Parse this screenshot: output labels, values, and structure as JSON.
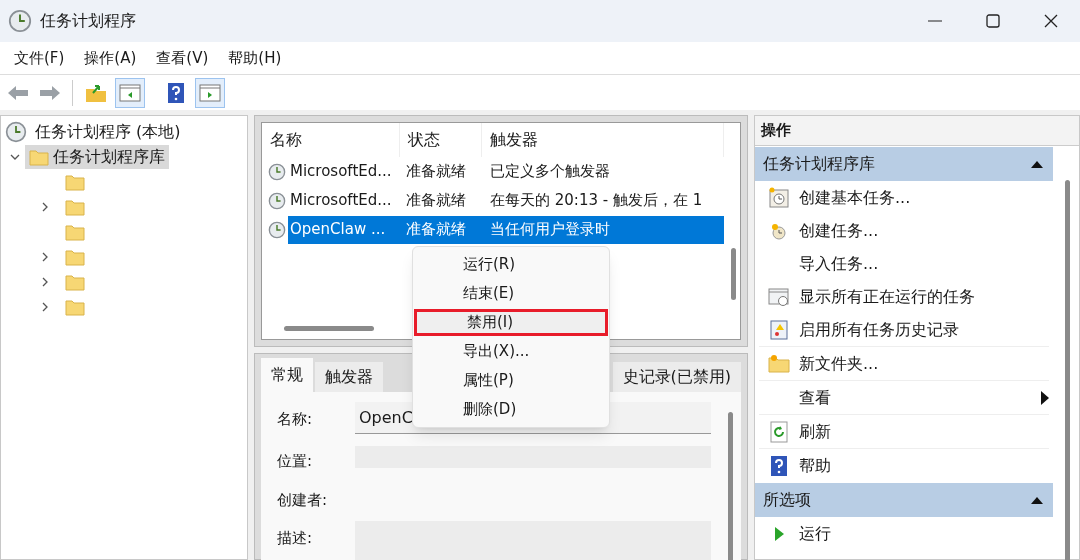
{
  "window": {
    "title": "任务计划程序"
  },
  "menu_bar": [
    "文件(F)",
    "操作(A)",
    "查看(V)",
    "帮助(H)"
  ],
  "tree": {
    "label": "任务计划程序 (本地)",
    "children": [
      {
        "label": "任务计划程序库",
        "selected": true,
        "expanded": true,
        "children": [
          {
            "expandable": false
          },
          {
            "expandable": true
          },
          {
            "expandable": false
          },
          {
            "expandable": true
          },
          {
            "expandable": true
          },
          {
            "expandable": true
          }
        ]
      }
    ]
  },
  "task_table": {
    "columns": [
      "名称",
      "状态",
      "触发器"
    ],
    "rows": [
      {
        "name": "MicrosoftEd...",
        "status": "准备就绪",
        "trigger": "已定义多个触发器",
        "selected": false
      },
      {
        "name": "MicrosoftEd...",
        "status": "准备就绪",
        "trigger": "在每天的 20:13 - 触发后，在 1",
        "selected": false
      },
      {
        "name": "OpenClaw ...",
        "status": "准备就绪",
        "trigger": "当任何用户登录时",
        "selected": true
      }
    ]
  },
  "context_menu": [
    {
      "label": "运行(R)",
      "highlighted": false
    },
    {
      "label": "结束(E)",
      "highlighted": false
    },
    {
      "label": "禁用(I)",
      "highlighted": true
    },
    {
      "label": "导出(X)...",
      "highlighted": false
    },
    {
      "label": "属性(P)",
      "highlighted": false
    },
    {
      "label": "删除(D)",
      "highlighted": false
    }
  ],
  "detail_tabs": [
    {
      "label": "常规",
      "selected": true
    },
    {
      "label": "触发器",
      "selected": false
    },
    {
      "label": "史记录(已禁用)",
      "selected": false
    }
  ],
  "detail_fields": [
    {
      "label": "名称:",
      "value": "OpenC"
    },
    {
      "label": "位置:"
    },
    {
      "label": "创建者:"
    },
    {
      "label": "描述:"
    }
  ],
  "actions": {
    "title": "操作",
    "sections": [
      {
        "title": "任务计划程序库",
        "expanded": true,
        "groups": [
          [
            {
              "label": "创建基本任务..."
            },
            {
              "label": "创建任务..."
            },
            {
              "label": "导入任务..."
            },
            {
              "label": "显示所有正在运行的任务"
            },
            {
              "label": "启用所有任务历史记录"
            }
          ],
          [
            {
              "label": "新文件夹..."
            }
          ],
          [
            {
              "label": "查看",
              "submenu": true
            }
          ],
          [
            {
              "label": "刷新"
            }
          ],
          [
            {
              "label": "帮助"
            }
          ]
        ]
      },
      {
        "title": "所选项",
        "expanded": true,
        "groups": [
          [
            {
              "label": "运行"
            }
          ]
        ]
      }
    ]
  }
}
